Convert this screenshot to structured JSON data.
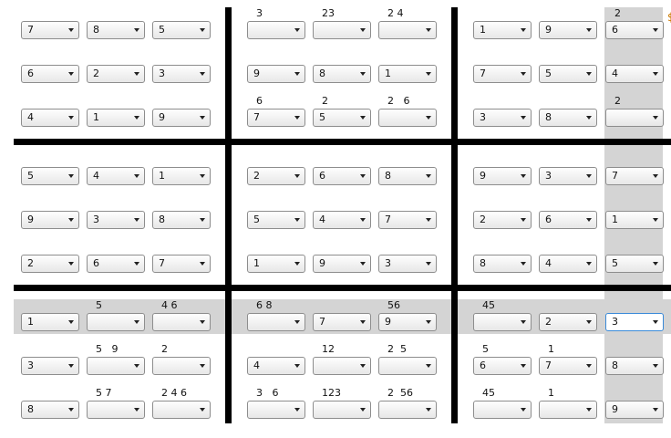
{
  "colors": {
    "highlight": "#d4d4d4",
    "grid_line": "#000000",
    "selected_border": "#3a8ad8"
  },
  "icons": {
    "dropdown": "chevron-down-icon"
  },
  "selected_cell": {
    "row": 6,
    "col": 8
  },
  "highlight": {
    "row": 6,
    "col": 8
  },
  "grid": [
    [
      "7",
      "8",
      "5",
      "",
      "",
      "",
      "1",
      "9",
      "6"
    ],
    [
      "6",
      "2",
      "3",
      "9",
      "8",
      "1",
      "7",
      "5",
      "4"
    ],
    [
      "4",
      "1",
      "9",
      "7",
      "5",
      "",
      "3",
      "8",
      ""
    ],
    [
      "5",
      "4",
      "1",
      "2",
      "6",
      "8",
      "9",
      "3",
      "7"
    ],
    [
      "9",
      "3",
      "8",
      "5",
      "4",
      "7",
      "2",
      "6",
      "1"
    ],
    [
      "2",
      "6",
      "7",
      "1",
      "9",
      "3",
      "8",
      "4",
      "5"
    ],
    [
      "1",
      "",
      "",
      "",
      "7",
      "9",
      "",
      "2",
      "3"
    ],
    [
      "3",
      "",
      "",
      "4",
      "",
      "",
      "6",
      "7",
      "8"
    ],
    [
      "8",
      "",
      "",
      "",
      "",
      "",
      "",
      "",
      "9"
    ]
  ],
  "candidates": [
    [
      "",
      "",
      "",
      "3",
      "23",
      "2 4",
      "",
      "",
      "2"
    ],
    [
      "",
      "",
      "",
      "",
      "",
      "",
      "",
      "",
      ""
    ],
    [
      "",
      "",
      "",
      "6",
      "2",
      "2   6",
      "",
      "",
      "2"
    ],
    [
      "",
      "",
      "",
      "",
      "",
      "",
      "",
      "",
      ""
    ],
    [
      "",
      "",
      "",
      "",
      "",
      "",
      "",
      "",
      ""
    ],
    [
      "",
      "",
      "",
      "",
      "",
      "",
      "",
      "",
      ""
    ],
    [
      "",
      "5",
      "4 6",
      "6 8",
      "",
      "56",
      "45",
      "",
      ""
    ],
    [
      "",
      "5   9",
      "2",
      "",
      "12",
      "2  5",
      "5",
      "1",
      ""
    ],
    [
      "",
      "5 7",
      "2 4 6",
      "3   6",
      "123",
      "2  56",
      "45",
      "1",
      ""
    ]
  ]
}
